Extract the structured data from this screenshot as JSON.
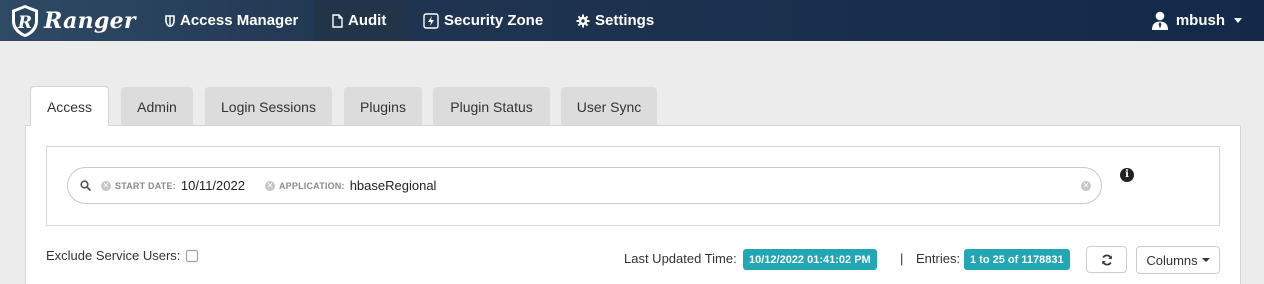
{
  "navbar": {
    "brand": "Ranger",
    "items": [
      {
        "label": "Access Manager",
        "icon": "shield-icon"
      },
      {
        "label": "Audit",
        "icon": "file-icon"
      },
      {
        "label": "Security Zone",
        "icon": "lightning-icon"
      },
      {
        "label": "Settings",
        "icon": "gear-icon"
      }
    ],
    "active_item": "Audit",
    "user": "mbush",
    "colors": {
      "bar_start": "#2f4a65",
      "bar_end": "#13294a",
      "active_bg": "#223447"
    }
  },
  "tabs": [
    {
      "label": "Access"
    },
    {
      "label": "Admin"
    },
    {
      "label": "Login Sessions"
    },
    {
      "label": "Plugins"
    },
    {
      "label": "Plugin Status"
    },
    {
      "label": "User Sync"
    }
  ],
  "active_tab": "Access",
  "search": {
    "facets": [
      {
        "category": "START DATE:",
        "value": "10/11/2022"
      },
      {
        "category": "APPLICATION:",
        "value": "hbaseRegional"
      }
    ]
  },
  "filters": {
    "exclude_service_users_label": "Exclude Service Users:",
    "exclude_service_users_checked": false
  },
  "status": {
    "last_updated_label": "Last Updated Time:",
    "last_updated_value": "10/12/2022 01:41:02 PM",
    "separator": "|",
    "entries_label": "Entries:",
    "entries_value": "1 to 25 of 1178831",
    "badge_color": "#23a6b3"
  },
  "columns_button": "Columns"
}
